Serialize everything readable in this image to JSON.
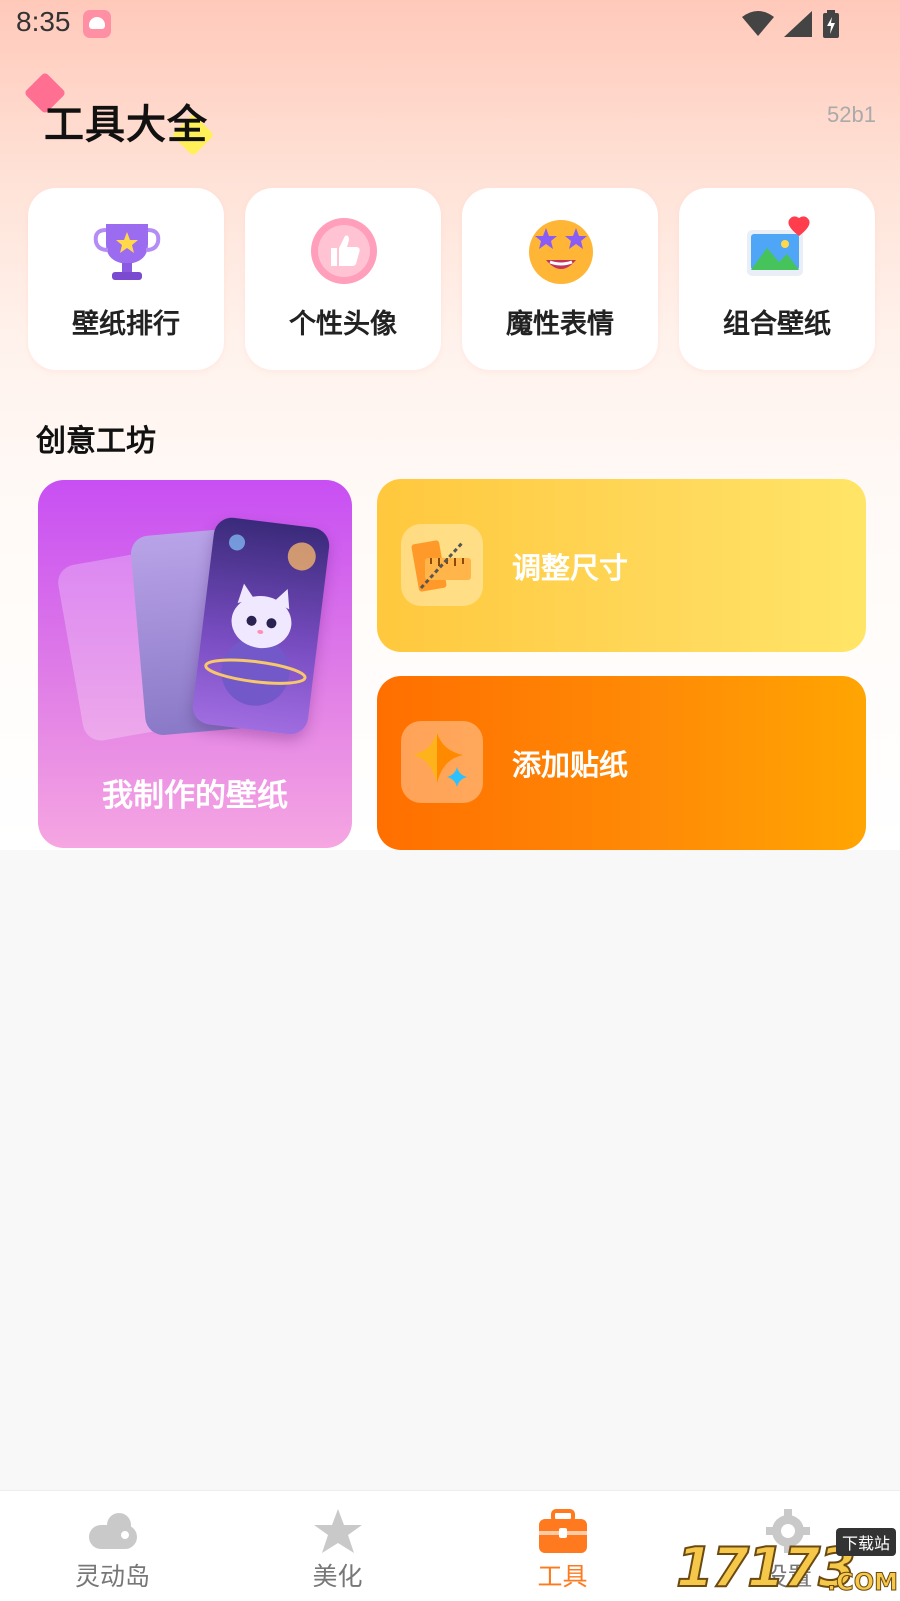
{
  "status_bar": {
    "time": "8:35"
  },
  "header": {
    "title": "工具大全",
    "version": "52b1"
  },
  "quick_tools": [
    {
      "label": "壁纸排行",
      "icon": "trophy-icon"
    },
    {
      "label": "个性头像",
      "icon": "thumbs-up-icon"
    },
    {
      "label": "魔性表情",
      "icon": "star-eyes-emoji-icon"
    },
    {
      "label": "组合壁纸",
      "icon": "picture-heart-icon"
    }
  ],
  "creative": {
    "section_title": "创意工坊",
    "my_wallpaper_label": "我制作的壁纸",
    "resize_label": "调整尺寸",
    "sticker_label": "添加贴纸"
  },
  "tabbar": {
    "tabs": [
      {
        "label": "灵动岛",
        "icon": "cloud-icon"
      },
      {
        "label": "美化",
        "icon": "star-icon"
      },
      {
        "label": "工具",
        "icon": "briefcase-icon"
      },
      {
        "label": "设置",
        "icon": "gear-icon"
      }
    ],
    "active_index": 2,
    "active_color": "#ff7a1e"
  },
  "watermark": {
    "number": "17173",
    "tag": "下载站",
    "suffix": ".COM"
  }
}
